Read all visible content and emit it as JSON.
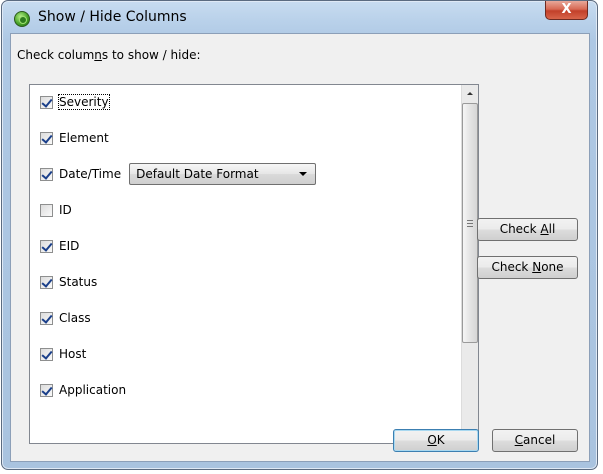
{
  "window": {
    "title": "Show / Hide Columns",
    "close_label": "X"
  },
  "dialog": {
    "prompt_before": "Check colum",
    "prompt_accel": "n",
    "prompt_after": "s to show / hide:"
  },
  "columns": [
    {
      "label": "Severity",
      "checked": true
    },
    {
      "label": "Element",
      "checked": true
    },
    {
      "label": "Date/Time",
      "checked": true
    },
    {
      "label": "ID",
      "checked": false
    },
    {
      "label": "EID",
      "checked": true
    },
    {
      "label": "Status",
      "checked": true
    },
    {
      "label": "Class",
      "checked": true
    },
    {
      "label": "Host",
      "checked": true
    },
    {
      "label": "Application",
      "checked": true
    }
  ],
  "date_format": {
    "selected": "Default Date Format"
  },
  "buttons": {
    "check_all_before": "Check ",
    "check_all_accel": "A",
    "check_all_after": "ll",
    "check_none_before": "Check ",
    "check_none_accel": "N",
    "check_none_after": "one",
    "ok_accel": "O",
    "ok_after": "K",
    "cancel_accel": "C",
    "cancel_after": "ancel"
  },
  "colors": {
    "window_frame": "#a9c3df",
    "client_bg": "#f0f0f0",
    "close_button": "#c2402a",
    "checkmark": "#1a3f8a"
  },
  "icons": {
    "app": "green-orb-icon",
    "dropdown": "chevron-down-icon",
    "scroll_up": "arrow-up-icon",
    "scroll_down": "arrow-down-icon"
  }
}
